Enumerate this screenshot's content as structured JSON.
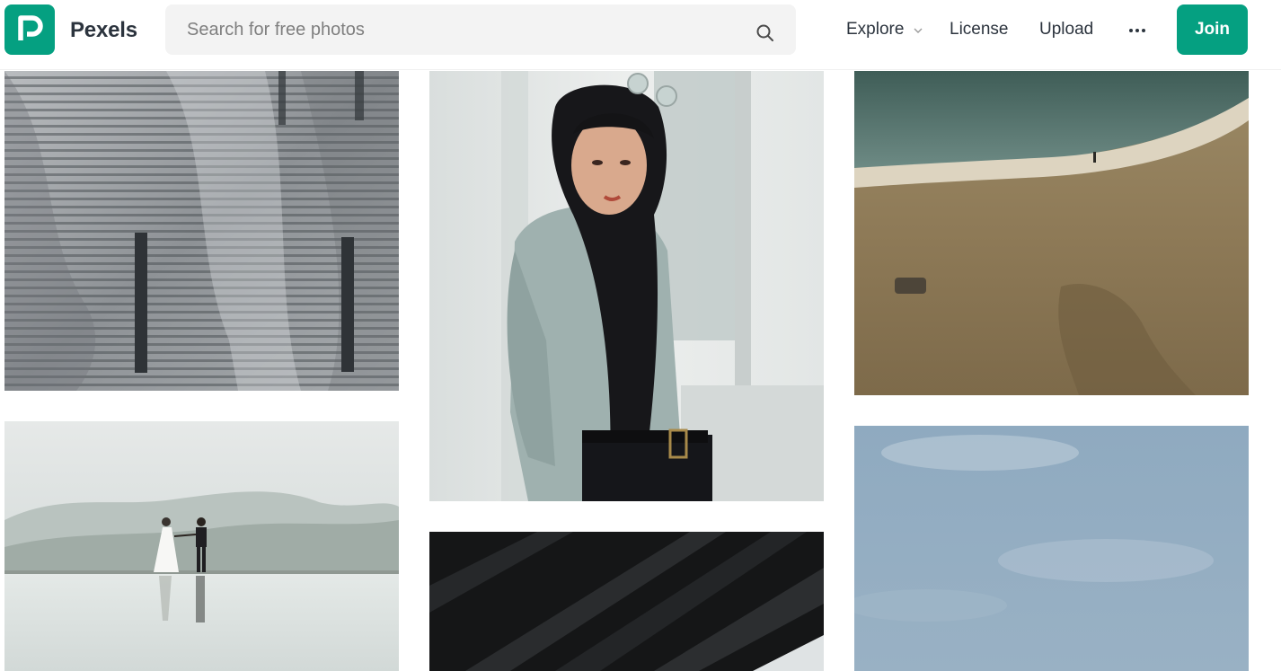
{
  "header": {
    "brand": "Pexels",
    "search_placeholder": "Search for free photos",
    "nav": {
      "explore": "Explore",
      "license": "License",
      "upload": "Upload",
      "more_icon": "ellipsis-icon"
    },
    "join_label": "Join",
    "logo_icon": "pexels-logo-icon",
    "search_icon": "search-icon"
  },
  "colors": {
    "brand": "#05a081",
    "text": "#2c343e",
    "search_bg": "#f3f3f3"
  },
  "photos": [
    {
      "id": "photo-metal-facade",
      "subject": "wavy metal building facade"
    },
    {
      "id": "photo-woman-wall",
      "subject": "woman in black scarf leaning on wall"
    },
    {
      "id": "photo-beach",
      "subject": "sandy beach with shoreline"
    },
    {
      "id": "photo-wedding",
      "subject": "couple walking on reflective water"
    },
    {
      "id": "photo-dark-roof",
      "subject": "dark ribbed ceiling"
    },
    {
      "id": "photo-sky",
      "subject": "blue sky"
    }
  ]
}
